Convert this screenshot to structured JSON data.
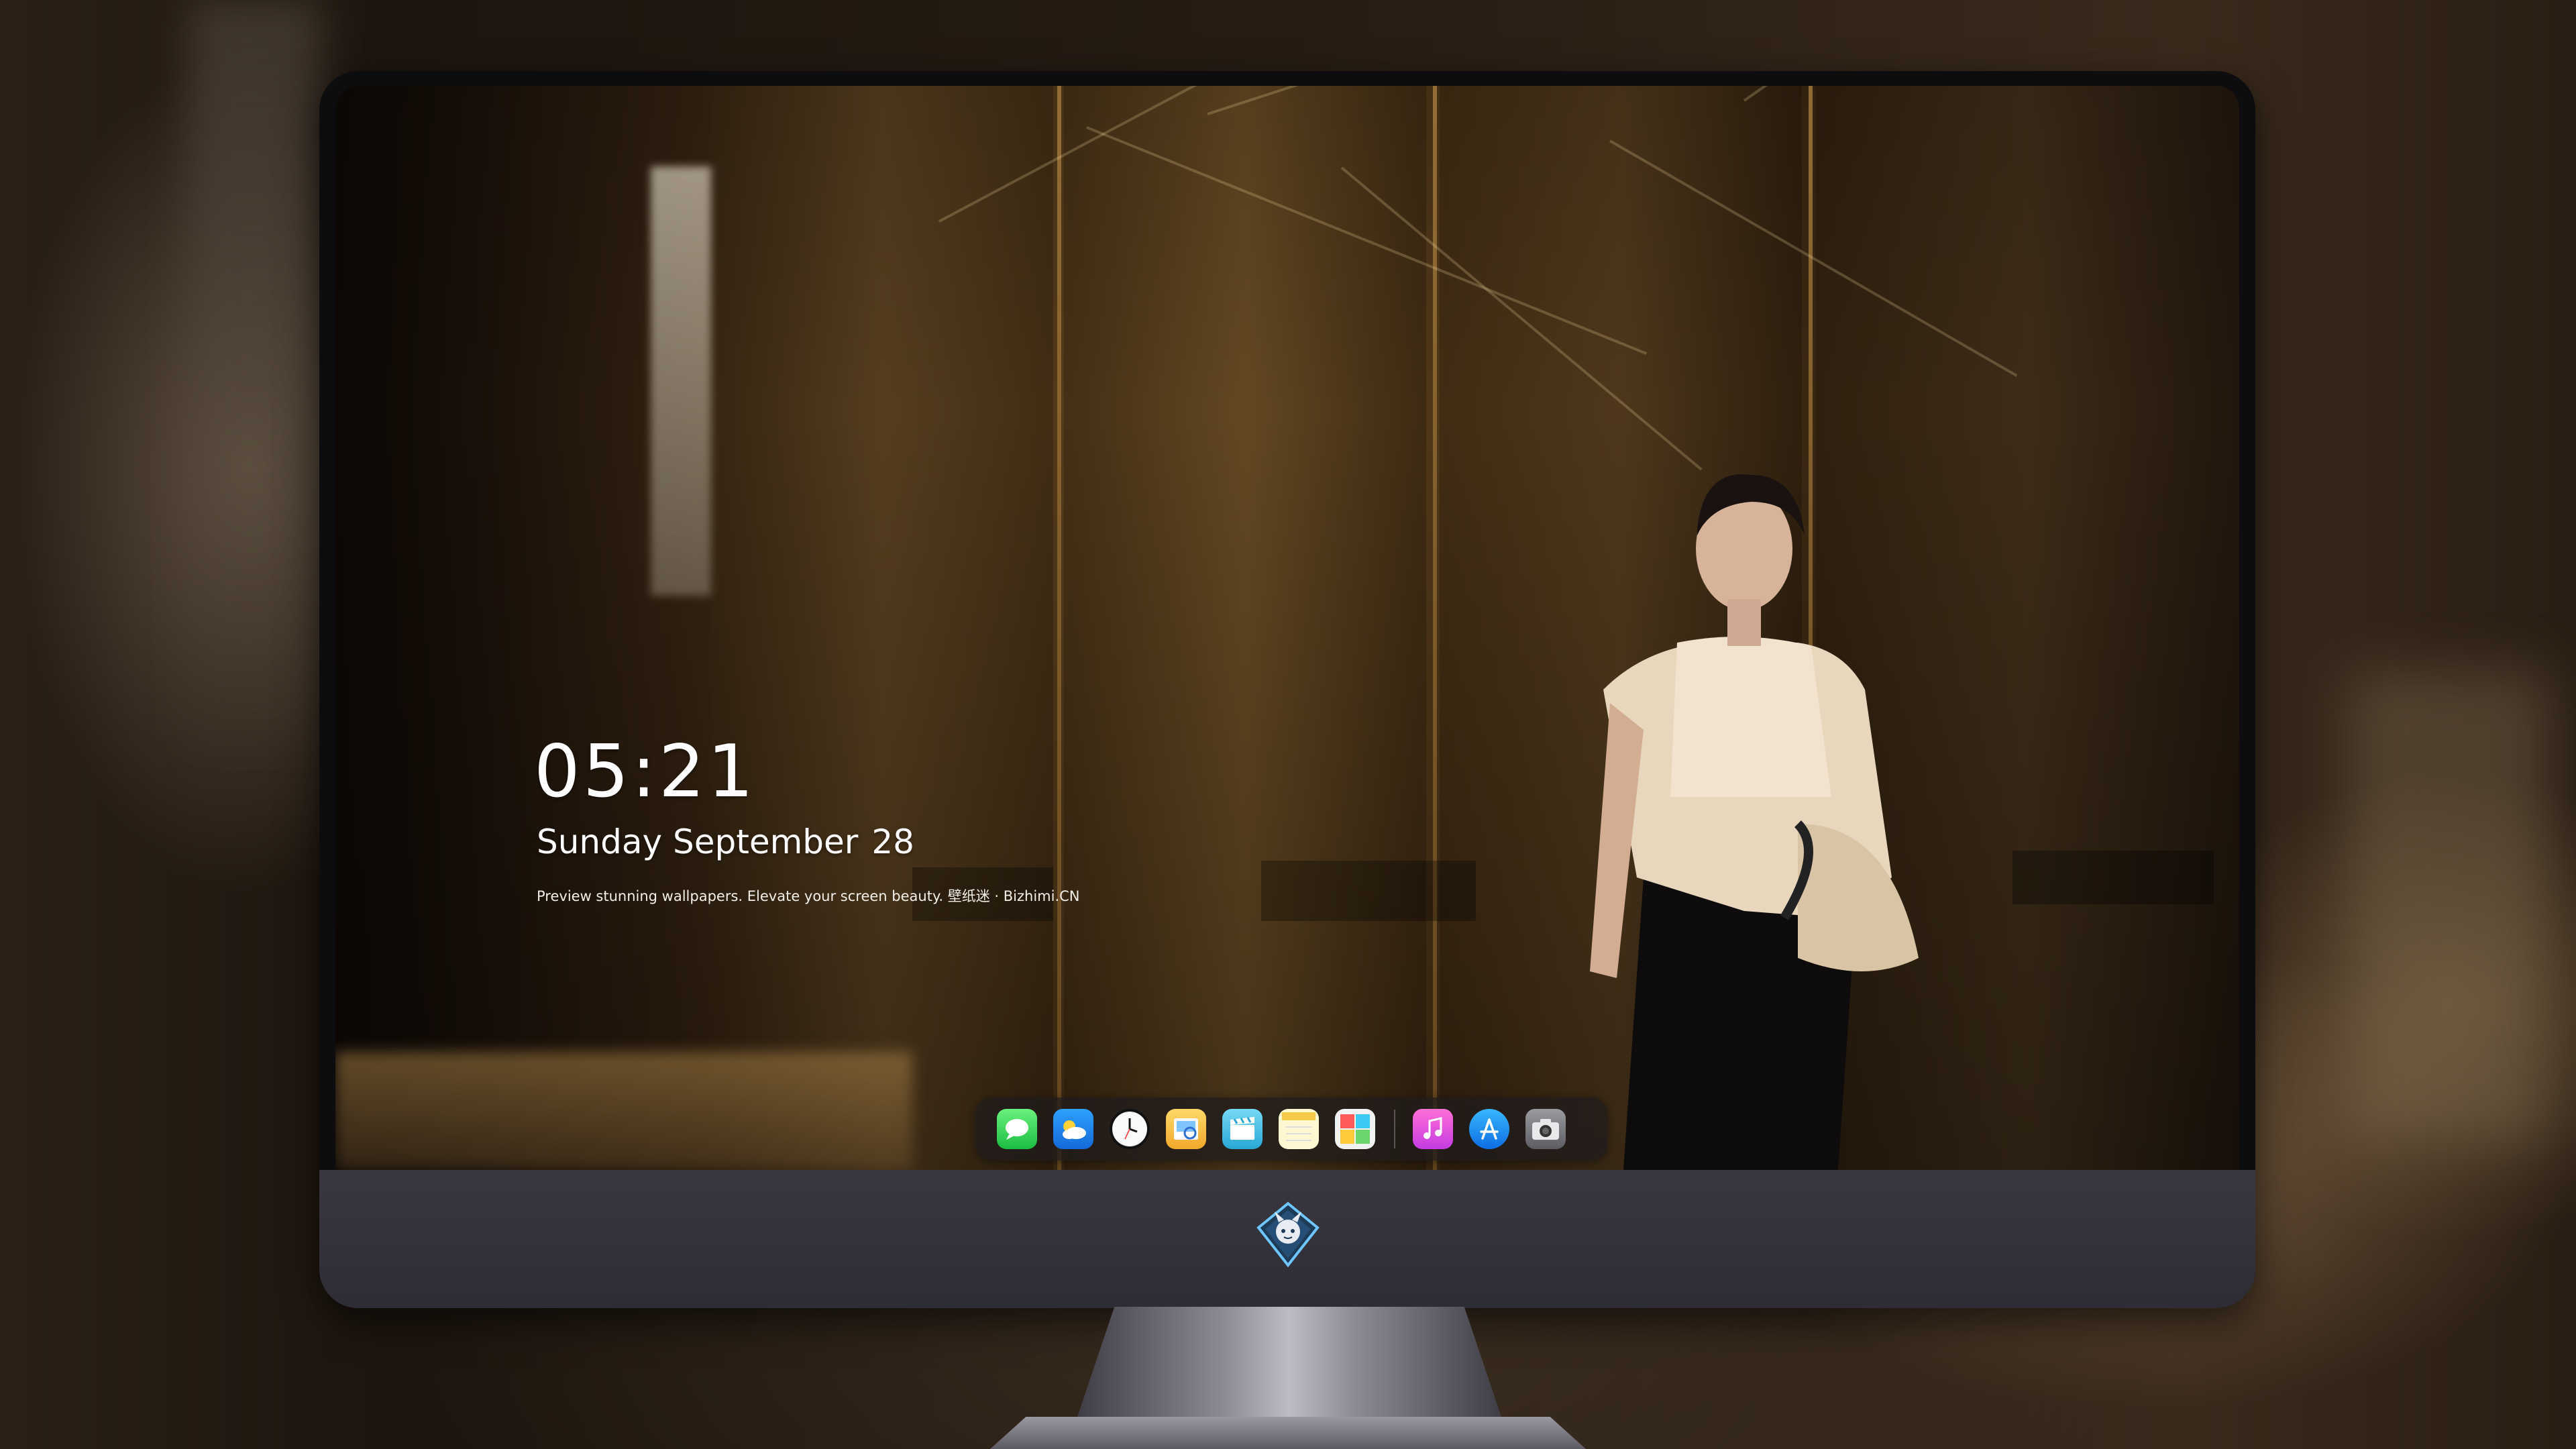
{
  "lock_screen": {
    "time": "05:21",
    "date_label": "Sunday September",
    "day_number": "28",
    "tagline": "Preview stunning wallpapers. Elevate your screen beauty. 壁纸迷 · Bizhimi.CN"
  },
  "dock": {
    "apps": [
      {
        "name": "messages-icon",
        "color": "#2fd15a"
      },
      {
        "name": "weather-icon",
        "color": "#2f8cf0"
      },
      {
        "name": "clock-icon",
        "color": "#f5f5f5"
      },
      {
        "name": "preview-icon",
        "color": "#f6c546"
      },
      {
        "name": "clips-icon",
        "color": "#5fc6e8"
      },
      {
        "name": "notes-icon",
        "color": "#fdf3c6"
      },
      {
        "name": "photo-booth-icon",
        "color": "#f4f4f4"
      },
      {
        "name": "itunes-icon",
        "color": "#f05fd0"
      },
      {
        "name": "app-store-icon",
        "color": "#1e86ee"
      },
      {
        "name": "camera-icon",
        "color": "#8a8a8e"
      }
    ]
  },
  "branding": {
    "logo": "mascot-shield-logo"
  }
}
